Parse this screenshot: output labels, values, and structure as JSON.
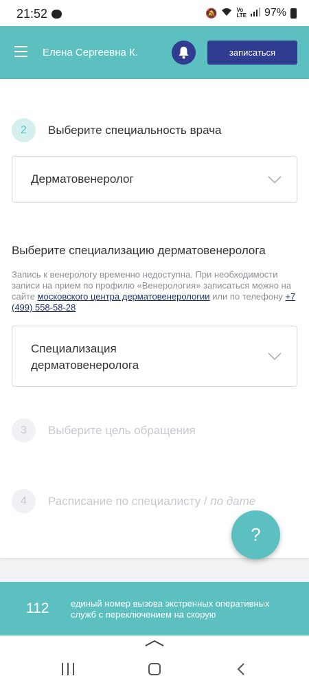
{
  "status_bar": {
    "time": "21:52",
    "battery": "97%",
    "icons": [
      "message-icon",
      "mute-icon",
      "wifi-icon",
      "volte-icon",
      "signal-icon",
      "battery-icon"
    ]
  },
  "header": {
    "user_name": "Елена Сергеевна К.",
    "signup_label": "записаться",
    "bell_icon": "bell-icon"
  },
  "steps": {
    "step2": {
      "number": "2",
      "title": "Выберите специальность врача"
    },
    "step3": {
      "number": "3",
      "title": "Выберите цель обращения"
    },
    "step4": {
      "number": "4",
      "title": "Расписание по специалисту",
      "separator": " / ",
      "title_alt": "по дате"
    }
  },
  "specialty_select": {
    "value": "Дерматовенеролог"
  },
  "specialization": {
    "title": "Выберите специализацию дерматовенеролога",
    "note_text": "Запись к венерологу временно недоступна. При необходимости записи на прием по профилю «Венерология» записаться можно на сайте ",
    "note_link": "московского центра дерматовенерологии",
    "note_mid": " или по телефону ",
    "note_phone": "+7 (499) 558-58-28",
    "select_placeholder": "Специализация дерматовенеролога"
  },
  "help": {
    "label": "?"
  },
  "emergency": {
    "number": "112",
    "text": "единый номер вызова экстренных оперативных служб с переключением на скорую"
  },
  "colors": {
    "teal": "#5cbfc0",
    "navy": "#2f3c8f",
    "link": "#1c2e6b",
    "muted": "#c7c9d1"
  }
}
